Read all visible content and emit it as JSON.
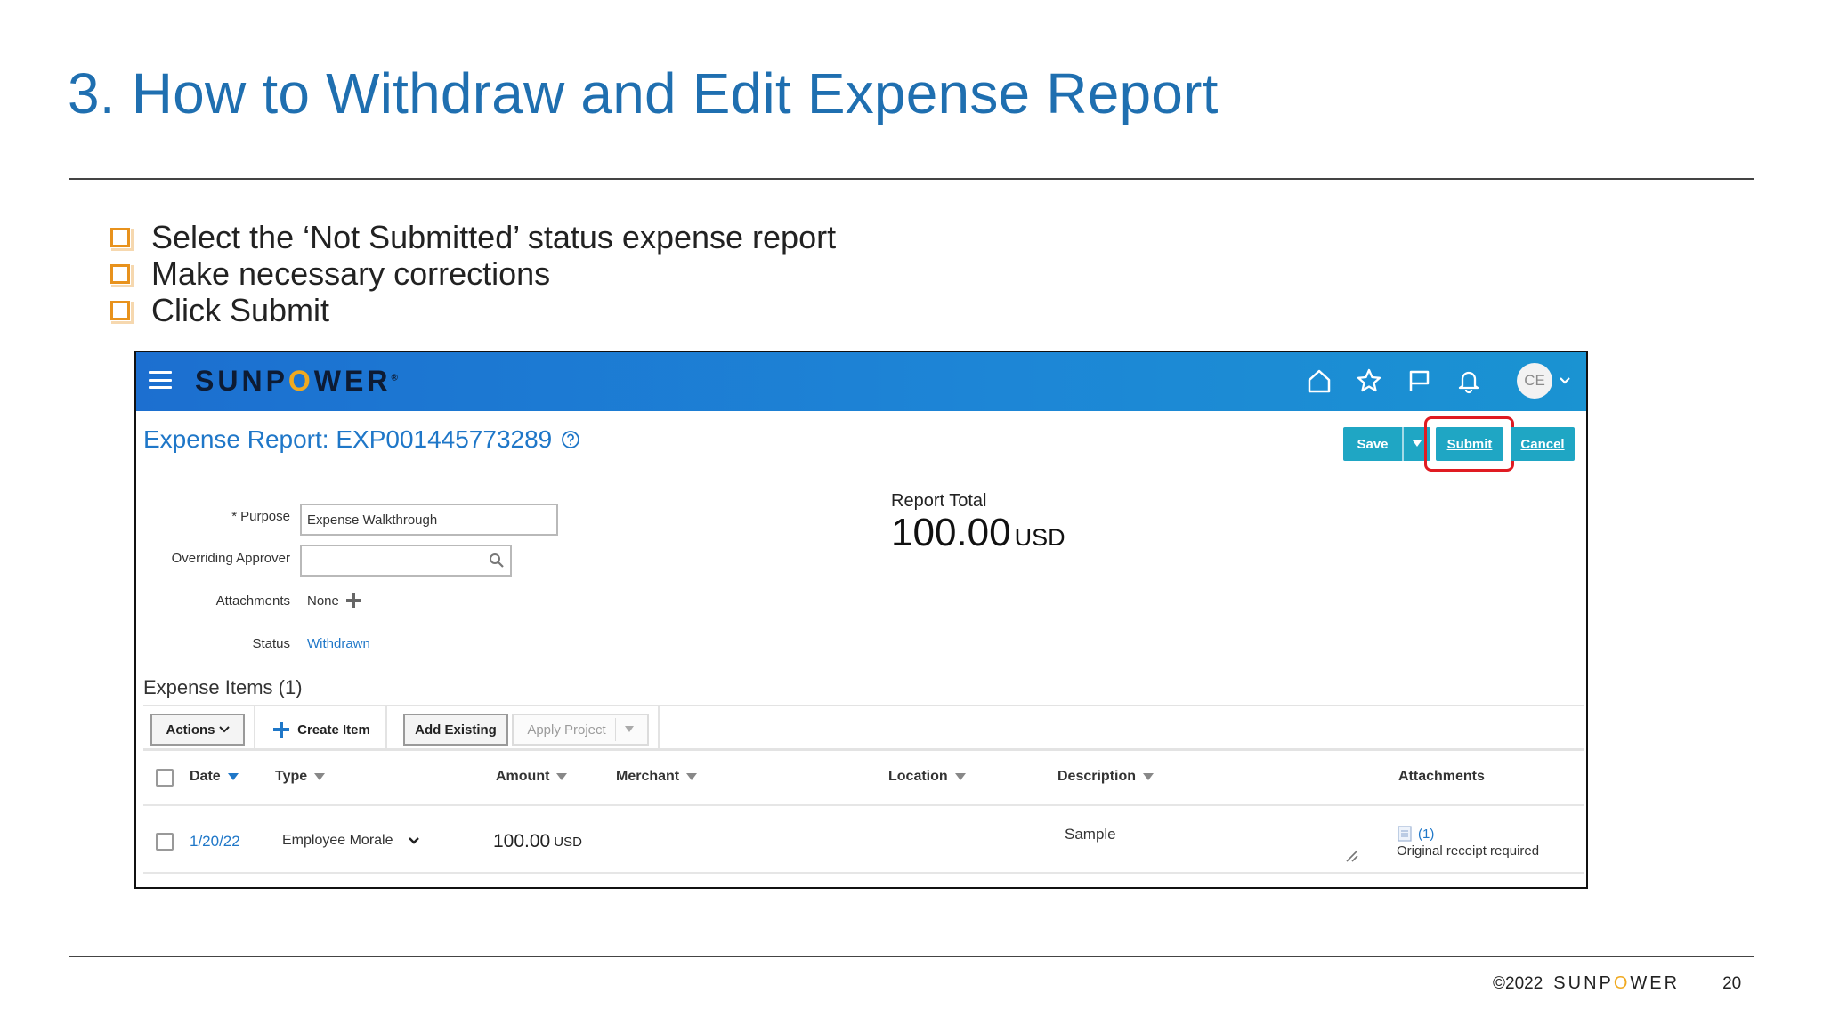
{
  "slide": {
    "title": "3. How to Withdraw and Edit Expense Report",
    "bullets": [
      "Select the ‘Not Submitted’ status expense report",
      "Make necessary corrections",
      "Click Submit"
    ],
    "footer": {
      "copyright": "©2022",
      "brand_prefix": "SUNP",
      "brand_o": "O",
      "brand_suffix": "WER",
      "page_number": "20"
    },
    "bullet_color": "#e8921c",
    "title_color": "#1f6fb0"
  },
  "app": {
    "logo": {
      "prefix": "SUNP",
      "o": "O",
      "suffix": "WER",
      "mark": "®"
    },
    "nav_icons": [
      "home-icon",
      "star-icon",
      "flag-icon",
      "bell-icon"
    ],
    "avatar_initials": "CE",
    "page_heading": "Expense Report: EXP001445773289",
    "buttons": {
      "save": "Save",
      "submit": "Submit",
      "cancel": "Cancel"
    },
    "form": {
      "purpose_label": "Purpose",
      "purpose_value": "Expense Walkthrough",
      "approver_label": "Overriding Approver",
      "approver_value": "",
      "attachments_label": "Attachments",
      "attachments_value": "None",
      "status_label": "Status",
      "status_value": "Withdrawn"
    },
    "report_total": {
      "label": "Report Total",
      "amount": "100.00",
      "currency": "USD"
    },
    "items": {
      "title": "Expense Items (1)",
      "toolbar": {
        "actions": "Actions",
        "create": "Create Item",
        "add_existing": "Add Existing",
        "apply_project": "Apply Project"
      },
      "columns": [
        "Date",
        "Type",
        "Amount",
        "Merchant",
        "Location",
        "Description",
        "Attachments"
      ],
      "rows": [
        {
          "date": "1/20/22",
          "type": "Employee Morale",
          "amount": "100.00",
          "currency": "USD",
          "merchant": "",
          "location": "",
          "description": "Sample",
          "attachment_count": "(1)",
          "attachment_note": "Original receipt required"
        }
      ]
    },
    "colors": {
      "appbar": "#1c6fd0",
      "accent_button": "#1fa6c4",
      "highlight": "#e01b22",
      "link": "#1f77c8"
    }
  }
}
